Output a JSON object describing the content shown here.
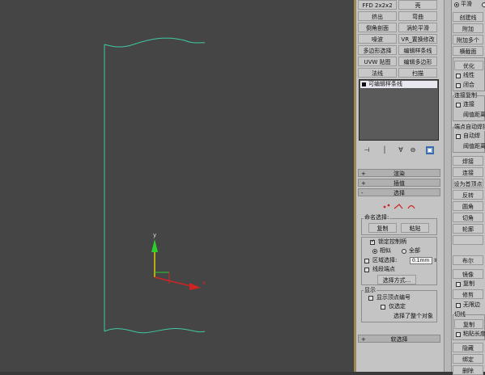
{
  "axis_labels": {
    "y": "y",
    "x": "x"
  },
  "modifier_buttons": [
    [
      "FFD 2x2x2",
      "壳"
    ],
    [
      "挤出",
      "弯曲"
    ],
    [
      "倒角剖面",
      "涡轮平滑"
    ],
    [
      "噪波",
      "VR_置换修改"
    ],
    [
      "多边形选择",
      "编辑样条线"
    ],
    [
      "UVW 贴图",
      "编辑多边形"
    ],
    [
      "法线",
      "扫描"
    ]
  ],
  "stack_item": "可编辑样条线",
  "stack_toolbar": [
    "⊣",
    "│",
    "∀",
    "⊖",
    "▣"
  ],
  "rollouts": {
    "render": "渲染",
    "interp": "插值",
    "select": "选择",
    "soft": "软选择"
  },
  "select_section": {
    "named_sel_title": "命名选择:",
    "copy": "复制",
    "paste": "粘贴",
    "lock_handles": "锁定控制柄",
    "similar": "相似",
    "all": "全部",
    "area_select": "区域选择:",
    "area_value": "0.1mm",
    "segment_end": "线段端点",
    "select_by": "选择方式...",
    "display_title": "显示",
    "show_vertex_num": "显示顶点编号",
    "only_selected": "仅选定",
    "status": "选择了整个对象"
  },
  "right_panel": {
    "top_radio1": "平滑",
    "btn_create_line": "创建线",
    "btn_attach": "附加",
    "btn_attach_multi": "附加多个",
    "btn_cross_section": "横截面",
    "btn_optimize": "优化",
    "cb_linear": "线性",
    "cb_closed": "闭合",
    "grp_connect_copy": "连接复制",
    "cb_connect": "连接",
    "threshold1": "阈值距离",
    "grp_end_auto": "端点自动焊接",
    "cb_auto_weld": "自动焊",
    "threshold2": "阈值距离",
    "btn_weld": "焊接",
    "btn_connect": "连接",
    "btn_set_first": "设为首顶点",
    "btn_reverse": "反转",
    "btn_fillet": "圆角",
    "btn_chamfer": "切角",
    "btn_outline": "轮廓",
    "btn_boolean": "布尔",
    "btn_mirror": "镜像",
    "cb_copy": "复制",
    "btn_trim": "修剪",
    "cb_infinite": "无限边",
    "grp_tangent": "切线",
    "btn_copy": "复制",
    "cb_paste_len": "粘贴长度",
    "btn_hide": "隐藏",
    "btn_bind": "绑定",
    "btn_delete": "删除"
  },
  "colors": {
    "spline": "#3fc9a4",
    "axis_y": "#2bd02b",
    "axis_x": "#d02424",
    "viewport": "#454545"
  }
}
